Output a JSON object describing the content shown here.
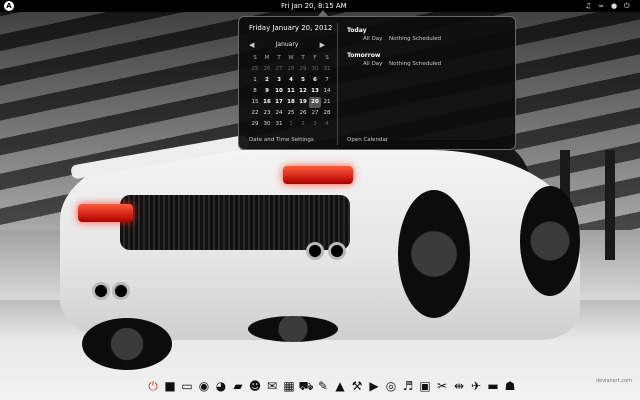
{
  "top_panel": {
    "activities_glyph": "A",
    "clock": "Fri Jan 20,  8:15 AM",
    "tray_icons": [
      "speaker-icon",
      "wifi-icon",
      "user-icon",
      "power-icon"
    ]
  },
  "calendar": {
    "date_heading": "Friday January 20, 2012",
    "month": "January",
    "prev_glyph": "◀",
    "next_glyph": "▶",
    "weekdays": [
      "S",
      "M",
      "T",
      "W",
      "T",
      "F",
      "S"
    ],
    "weeks": [
      [
        {
          "d": "25",
          "s": "other"
        },
        {
          "d": "26",
          "s": "other"
        },
        {
          "d": "27",
          "s": "other"
        },
        {
          "d": "28",
          "s": "other"
        },
        {
          "d": "29",
          "s": "other"
        },
        {
          "d": "30",
          "s": "other"
        },
        {
          "d": "31",
          "s": "other"
        }
      ],
      [
        {
          "d": "1",
          "s": ""
        },
        {
          "d": "2",
          "s": "bold"
        },
        {
          "d": "3",
          "s": "bold"
        },
        {
          "d": "4",
          "s": "bold"
        },
        {
          "d": "5",
          "s": "bold"
        },
        {
          "d": "6",
          "s": "bold"
        },
        {
          "d": "7",
          "s": ""
        }
      ],
      [
        {
          "d": "8",
          "s": ""
        },
        {
          "d": "9",
          "s": "bold"
        },
        {
          "d": "10",
          "s": "bold"
        },
        {
          "d": "11",
          "s": "bold"
        },
        {
          "d": "12",
          "s": "bold"
        },
        {
          "d": "13",
          "s": "bold"
        },
        {
          "d": "14",
          "s": ""
        }
      ],
      [
        {
          "d": "15",
          "s": ""
        },
        {
          "d": "16",
          "s": "bold"
        },
        {
          "d": "17",
          "s": "bold"
        },
        {
          "d": "18",
          "s": "bold"
        },
        {
          "d": "19",
          "s": "bold"
        },
        {
          "d": "20",
          "s": "today"
        },
        {
          "d": "21",
          "s": ""
        }
      ],
      [
        {
          "d": "22",
          "s": ""
        },
        {
          "d": "23",
          "s": ""
        },
        {
          "d": "24",
          "s": ""
        },
        {
          "d": "25",
          "s": ""
        },
        {
          "d": "26",
          "s": ""
        },
        {
          "d": "27",
          "s": ""
        },
        {
          "d": "28",
          "s": ""
        }
      ],
      [
        {
          "d": "29",
          "s": ""
        },
        {
          "d": "30",
          "s": ""
        },
        {
          "d": "31",
          "s": ""
        },
        {
          "d": "1",
          "s": "other"
        },
        {
          "d": "2",
          "s": "other"
        },
        {
          "d": "3",
          "s": "other"
        },
        {
          "d": "4",
          "s": "other"
        }
      ]
    ],
    "settings_link": "Date and Time Settings",
    "open_calendar_link": "Open Calendar"
  },
  "agenda": {
    "today_heading": "Today",
    "today_time": "All Day",
    "today_text": "Nothing Scheduled",
    "tomorrow_heading": "Tomorrow",
    "tomorrow_time": "All Day",
    "tomorrow_text": "Nothing Scheduled"
  },
  "dock": {
    "items": [
      {
        "name": "power-icon",
        "glyph": "⏻"
      },
      {
        "name": "terminal-icon",
        "glyph": "■"
      },
      {
        "name": "display-icon",
        "glyph": "▭"
      },
      {
        "name": "browser-icon",
        "glyph": "◉"
      },
      {
        "name": "firefox-icon",
        "glyph": "◕"
      },
      {
        "name": "files-icon",
        "glyph": "▰"
      },
      {
        "name": "chat-icon",
        "glyph": "☻"
      },
      {
        "name": "mail-icon",
        "glyph": "✉"
      },
      {
        "name": "calculator-icon",
        "glyph": "▦"
      },
      {
        "name": "cart-icon",
        "glyph": "⛟"
      },
      {
        "name": "brush-icon",
        "glyph": "✎"
      },
      {
        "name": "vlc-icon",
        "glyph": "▲"
      },
      {
        "name": "toolbox-icon",
        "glyph": "⚒"
      },
      {
        "name": "media-play-icon",
        "glyph": "▶"
      },
      {
        "name": "disc-icon",
        "glyph": "◎"
      },
      {
        "name": "guitar-icon",
        "glyph": "♬"
      },
      {
        "name": "image-icon",
        "glyph": "▣"
      },
      {
        "name": "tools-icon",
        "glyph": "✂"
      },
      {
        "name": "network-icon",
        "glyph": "⇹"
      },
      {
        "name": "plane-icon",
        "glyph": "✈"
      },
      {
        "name": "monitor-icon",
        "glyph": "▬"
      },
      {
        "name": "device-icon",
        "glyph": "☗"
      }
    ]
  },
  "watermark": "devianart.com"
}
